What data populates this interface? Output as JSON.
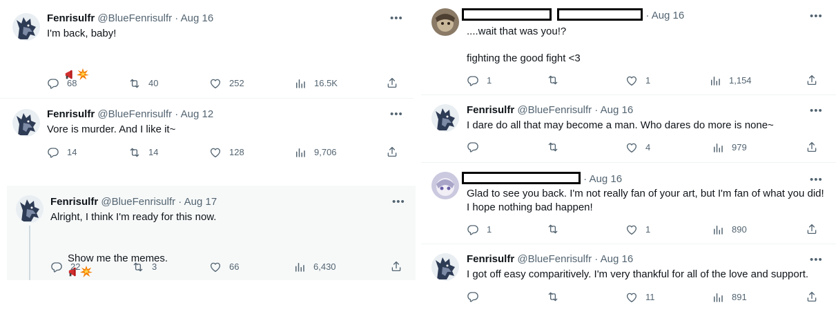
{
  "colors": {
    "text": "#0f1419",
    "secondary": "#536471",
    "divider": "#eff3f4",
    "shaded_bg": "#f7f9f9",
    "thread_line": "#cfd9de"
  },
  "icons": [
    "reply-icon",
    "retweet-icon",
    "like-icon",
    "views-icon",
    "share-icon",
    "more-icon"
  ],
  "left": {
    "tweet1": {
      "name": "Fenrisulfr",
      "handle": "@BlueFenrisulfr",
      "sep": "·",
      "date": "Aug 16",
      "text": "I'm back, baby!",
      "replies": "68",
      "retweets": "40",
      "likes": "252",
      "views": "16.5K"
    },
    "tweet2": {
      "name": "Fenrisulfr",
      "handle": "@BlueFenrisulfr",
      "sep": "·",
      "date": "Aug 12",
      "text": "Vore is murder. And I like it~",
      "replies": "14",
      "retweets": "14",
      "likes": "128",
      "views": "9,706"
    },
    "tweet3": {
      "name": "Fenrisulfr",
      "handle": "@BlueFenrisulfr",
      "sep": "·",
      "date": "Aug 17",
      "text1": "Alright, I think I'm ready for this now.",
      "text2": "Show me the memes.",
      "replies": "22",
      "retweets": "3",
      "likes": "66",
      "views": "6,430"
    }
  },
  "right": {
    "reply1": {
      "sep": "·",
      "date": "Aug 16",
      "text1": "....wait that was you!?",
      "text2": "fighting the good fight <3",
      "replies": "1",
      "retweets": "",
      "likes": "1",
      "views": "1,154"
    },
    "reply2": {
      "name": "Fenrisulfr",
      "handle": "@BlueFenrisulfr",
      "sep": "·",
      "date": "Aug 16",
      "text": "I dare do all that may become a man. Who dares do more is none~",
      "replies": "",
      "retweets": "",
      "likes": "4",
      "views": "979"
    },
    "reply3": {
      "sep": "·",
      "date": "Aug 16",
      "text": "Glad to see you back. I'm not really fan of your art, but I'm fan of what you did! I hope nothing bad happen!",
      "replies": "1",
      "retweets": "",
      "likes": "1",
      "views": "890"
    },
    "reply4": {
      "name": "Fenrisulfr",
      "handle": "@BlueFenrisulfr",
      "sep": "·",
      "date": "Aug 16",
      "text": "I got off easy comparitively. I'm very thankful for all of the love and support.",
      "replies": "",
      "retweets": "",
      "likes": "11",
      "views": "891"
    }
  }
}
